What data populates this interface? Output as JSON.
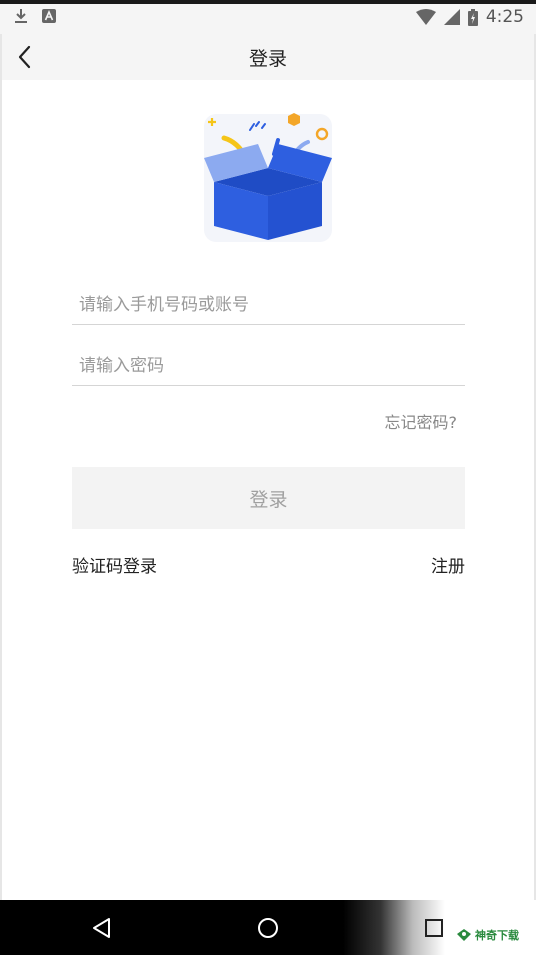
{
  "status_bar": {
    "time": "4:25",
    "icons": [
      "download-icon",
      "a-badge-icon",
      "wifi-icon",
      "signal-icon",
      "battery-icon"
    ]
  },
  "header": {
    "title": "登录",
    "back_icon": "chevron-left-icon"
  },
  "hero": {
    "icon": "gift-box-illustration",
    "colors": {
      "box": "#2e5fe0",
      "lid": "#8caaf0",
      "accent_yellow": "#f5c518",
      "accent_orange": "#f3a628"
    }
  },
  "form": {
    "account": {
      "placeholder": "请输入手机号码或账号",
      "value": ""
    },
    "password": {
      "placeholder": "请输入密码",
      "value": ""
    },
    "forgot_password": "忘记密码?",
    "login_button": "登录",
    "sms_login": "验证码登录",
    "register": "注册"
  },
  "nav_bar": {
    "icons": [
      "back-triangle-icon",
      "home-circle-icon",
      "recents-square-icon"
    ]
  },
  "watermark": {
    "text": "神奇下载"
  }
}
